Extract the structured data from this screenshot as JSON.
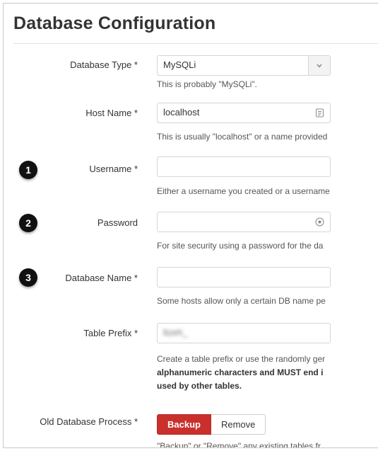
{
  "title": "Database Configuration",
  "fields": {
    "db_type": {
      "label": "Database Type *",
      "value": "MySQLi",
      "help": "This is probably \"MySQLi\"."
    },
    "host": {
      "label": "Host Name *",
      "value": "localhost",
      "help": "This is usually \"localhost\" or a name provided"
    },
    "username": {
      "step": "1",
      "label": "Username *",
      "value": "",
      "help": "Either a username you created or a username"
    },
    "password": {
      "step": "2",
      "label": "Password",
      "value": "",
      "help": "For site security using a password for the da"
    },
    "db_name": {
      "step": "3",
      "label": "Database Name *",
      "value": "",
      "help": "Some hosts allow only a certain DB name pe"
    },
    "prefix": {
      "label": "Table Prefix *",
      "value": "ltzeh_",
      "help_line1": "Create a table prefix or use the randomly ger",
      "help_line2": "alphanumeric characters and MUST end i",
      "help_line3": "used by other tables."
    },
    "old_process": {
      "label": "Old Database Process *",
      "backup_label": "Backup",
      "remove_label": "Remove",
      "help": "\"Backup\" or \"Remove\" any existing tables fr"
    }
  },
  "colors": {
    "accent_danger": "#c9302c",
    "badge": "#111111"
  }
}
